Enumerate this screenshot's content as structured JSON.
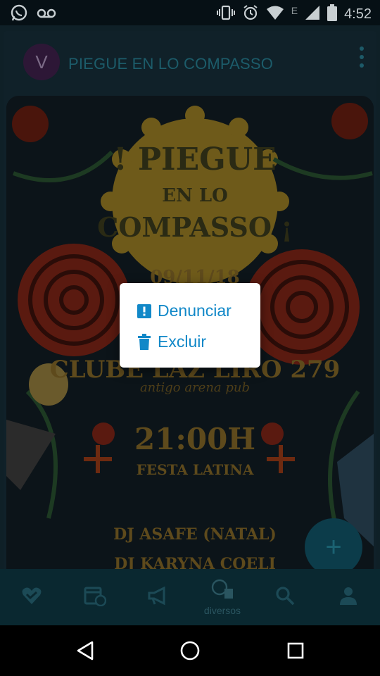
{
  "status_bar": {
    "left_icons": [
      "whatsapp-icon",
      "voicemail-icon"
    ],
    "right_icons": [
      "vibrate-icon",
      "alarm-icon",
      "wifi-icon",
      "signal-icon",
      "battery-icon"
    ],
    "network_letter": "E",
    "time": "4:52"
  },
  "card": {
    "avatar_letter": "V",
    "title": "PIEGUE EN LO COMPASSO",
    "menu_icon": "kebab-menu-icon"
  },
  "poster": {
    "headline": [
      "! PIEGUE",
      "EN LO",
      "COMPASSO ¡"
    ],
    "date": "09/11/18",
    "venue": "CLUBE LAZ LIRO 279",
    "venue_sub": "antigo arena pub",
    "time": "21:00H",
    "event": "FESTA LATINA",
    "djs": [
      "DJ ASAFE (NATAL)",
      "DJ KARYNA COELI"
    ]
  },
  "context_menu": {
    "items": [
      {
        "label": "Denunciar",
        "icon": "report-icon"
      },
      {
        "label": "Excluir",
        "icon": "trash-icon"
      }
    ],
    "accent": "#1188c8"
  },
  "bottom_nav": {
    "items": [
      {
        "icon": "heart-check-icon",
        "label": ""
      },
      {
        "icon": "calendar-clock-icon",
        "label": ""
      },
      {
        "icon": "megaphone-icon",
        "label": ""
      },
      {
        "icon": "globe-building-icon",
        "label": "diversos"
      },
      {
        "icon": "search-icon",
        "label": ""
      },
      {
        "icon": "person-icon",
        "label": ""
      }
    ]
  },
  "fab": {
    "symbol": "+"
  },
  "android_nav": [
    "back-icon",
    "home-icon",
    "recents-icon"
  ]
}
